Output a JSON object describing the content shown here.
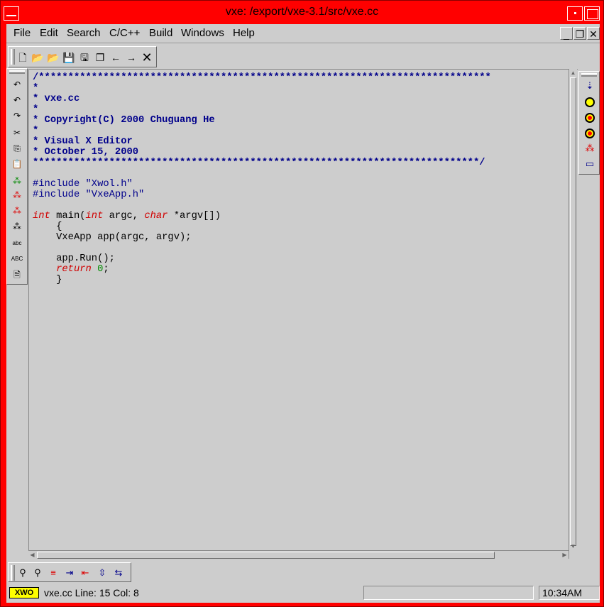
{
  "window": {
    "title": "vxe: /export/vxe-3.1/src/vxe.cc"
  },
  "menu": [
    {
      "label": "File"
    },
    {
      "label": "Edit"
    },
    {
      "label": "Search"
    },
    {
      "label": "C/C++"
    },
    {
      "label": "Build"
    },
    {
      "label": "Windows"
    },
    {
      "label": "Help"
    }
  ],
  "toolbar": {
    "icons": [
      "new-file-icon",
      "open-folder-icon",
      "open-recent-icon",
      "save-icon",
      "save-as-icon",
      "save-all-icon",
      "back-arrow-icon",
      "forward-arrow-icon",
      "close-icon"
    ]
  },
  "editor": {
    "lines": [
      "/*****************************************************************************",
      "*",
      "* vxe.cc",
      "*",
      "* Copyright(C) 2000 Chuguang He",
      "*",
      "* Visual X Editor",
      "* October 15, 2000",
      "****************************************************************************/",
      "",
      "#include \"Xwol.h\"",
      "#include \"VxeApp.h\"",
      "",
      "int main(int argc, char *argv[])",
      "    {",
      "    VxeApp app(argc, argv);",
      "",
      "    app.Run();",
      "    return 0;",
      "    }"
    ]
  },
  "statusbar": {
    "badge": "XWO",
    "file_info": "vxe.cc Line: 15  Col: 8",
    "message": "",
    "clock": "10:34AM"
  }
}
